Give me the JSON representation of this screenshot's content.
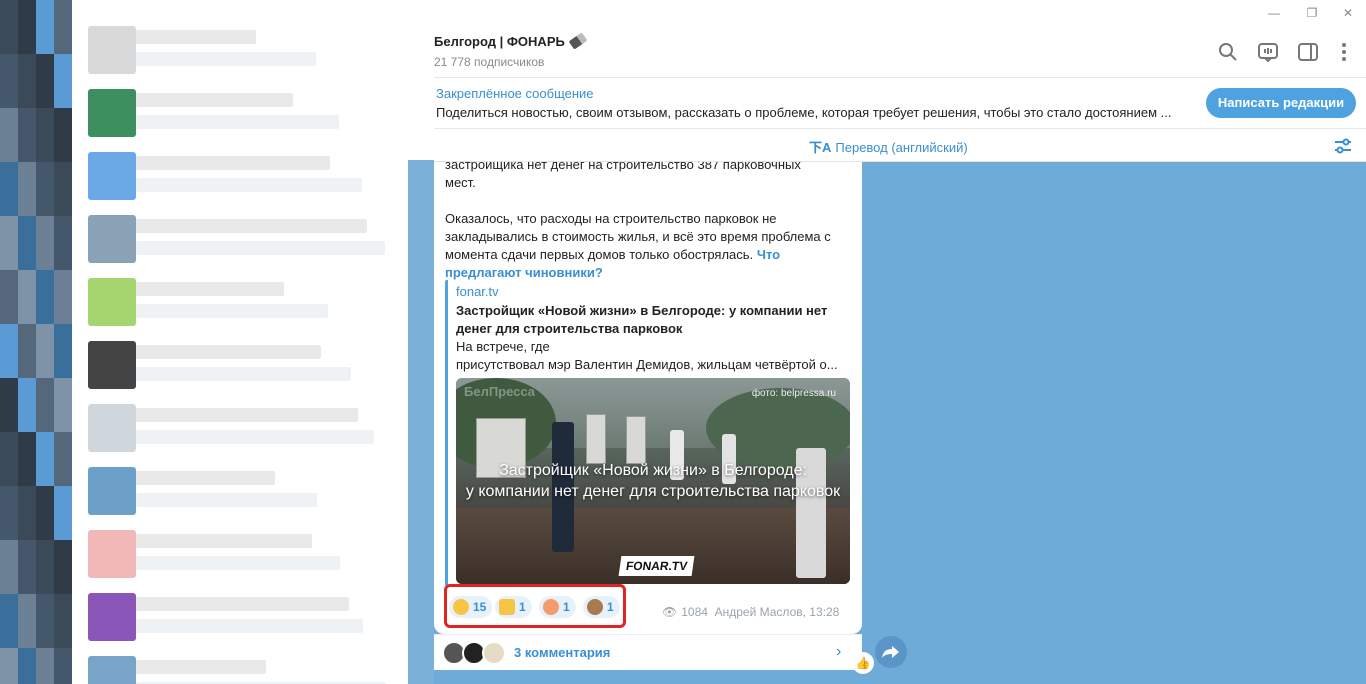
{
  "channel": {
    "title": "Белгород | ФОНАРЬ",
    "subscribers": "21 778 подписчиков"
  },
  "pinned": {
    "title": "Закреплённое сообщение",
    "text": "Поделиться новостью, своим отзывом, рассказать о проблеме, которая требует решения, чтобы это стало достоянием ...",
    "button_label": "Написать редакции"
  },
  "translate": {
    "label": "Перевод (английский)"
  },
  "message": {
    "line1": "застройщика нет денег на строительство 387 парковочных",
    "line2": "мест.",
    "para2_a": "Оказалось, что расходы на строительство парковок не",
    "para2_b": "закладывались в стоимость жилья, и всё это время проблема с",
    "para2_c": "момента сдачи первых домов только обострялась.",
    "link_a": "Что",
    "link_b": "предлагают чиновники?"
  },
  "preview": {
    "site": "fonar.tv",
    "title": "Застройщик «Новой жизни» в Белгороде: у компании нет денег для строительства парковок",
    "desc_line1": "На встрече, где",
    "desc_line2": "присутствовал мэр Валентин Демидов, жильцам четвёртой о...",
    "image_photo_credit": "фото: belpressa.ru",
    "image_brand": "БелПресса",
    "image_caption_line1": "Застройщик «Новой жизни» в Белгороде:",
    "image_caption_line2": "у компании нет денег для строительства парковок",
    "image_logo": "FONAR.TV"
  },
  "reactions": [
    {
      "emoji": "rofl-emoji",
      "count": "15"
    },
    {
      "emoji": "thumbs-up-emoji",
      "count": "1"
    },
    {
      "emoji": "exploding-head-emoji",
      "count": "1"
    },
    {
      "emoji": "see-no-evil-monkey-emoji",
      "count": "1"
    }
  ],
  "meta": {
    "views": "1084",
    "author_time": "Андрей Маслов, 13:28"
  },
  "comments": {
    "label": "3 комментария"
  },
  "colors": {
    "accent": "#3a8fd0",
    "button": "#4ea2e0",
    "chat_bg": "#6fabd9",
    "highlight": "#e02424"
  }
}
